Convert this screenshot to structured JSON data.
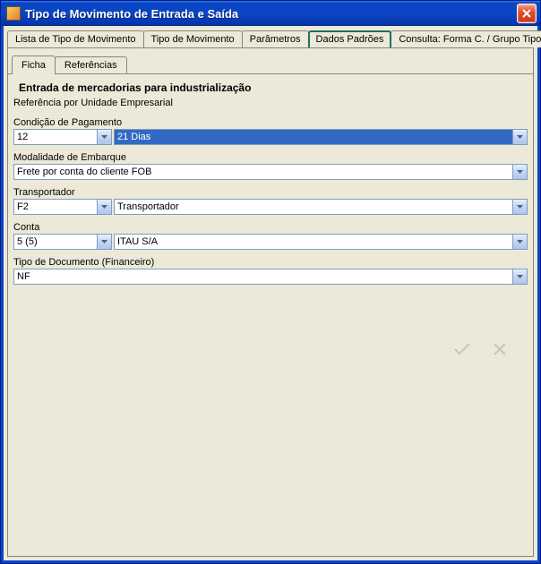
{
  "window": {
    "title": "Tipo de Movimento de Entrada e Saída"
  },
  "tabs_primary": [
    {
      "label": "Lista de Tipo de Movimento"
    },
    {
      "label": "Tipo de Movimento"
    },
    {
      "label": "Parâmetros"
    },
    {
      "label": "Dados Padrões"
    },
    {
      "label": "Consulta: Forma C. / Grupo Tipo Mov."
    }
  ],
  "tabs_secondary": [
    {
      "label": "Ficha"
    },
    {
      "label": "Referências"
    }
  ],
  "section": {
    "title": "Entrada de mercadorias para industrialização",
    "subtitle": "Referência por Unidade Empresarial"
  },
  "fields": {
    "cond_pag": {
      "label": "Condição de Pagamento",
      "code": "12",
      "desc": "21 Dias"
    },
    "modalidade": {
      "label": "Modalidade de Embarque",
      "value": "Frete por conta do cliente FOB"
    },
    "transportador": {
      "label": "Transportador",
      "code": "F2",
      "desc": "Transportador"
    },
    "conta": {
      "label": "Conta",
      "code": "5 (5)",
      "desc": "ITAU S/A"
    },
    "tipo_doc": {
      "label": "Tipo de Documento (Financeiro)",
      "value": "NF"
    }
  },
  "actions": {
    "confirm": "✓",
    "cancel": "✕"
  }
}
